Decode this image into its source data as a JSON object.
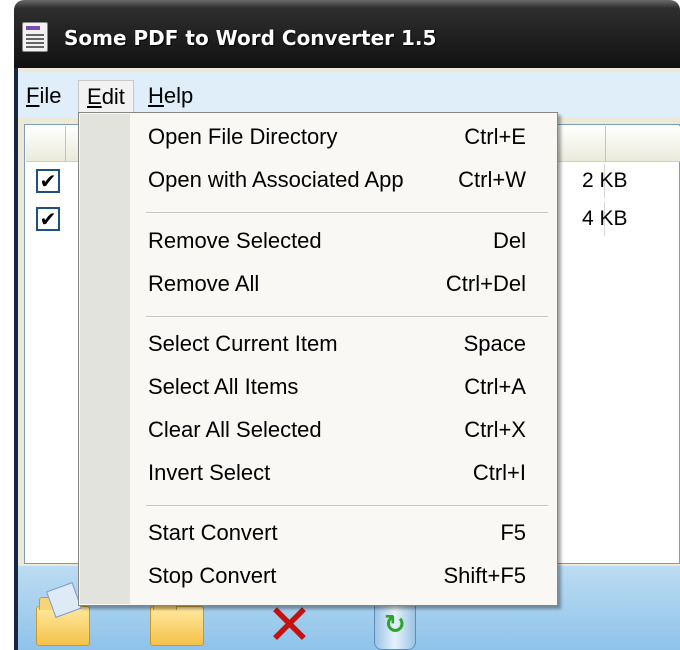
{
  "window": {
    "title": "Some PDF to Word Converter 1.5"
  },
  "menubar": {
    "items": [
      {
        "label": "File",
        "mnemonic": "F",
        "rest": "ile"
      },
      {
        "label": "Edit",
        "mnemonic": "E",
        "rest": "dit"
      },
      {
        "label": "Help",
        "mnemonic": "H",
        "rest": "elp"
      }
    ]
  },
  "edit_menu": {
    "groups": [
      [
        {
          "label": "Open File Directory",
          "shortcut": "Ctrl+E"
        },
        {
          "label": "Open with Associated App",
          "shortcut": "Ctrl+W"
        }
      ],
      [
        {
          "label": "Remove Selected",
          "shortcut": "Del"
        },
        {
          "label": "Remove All",
          "shortcut": "Ctrl+Del"
        }
      ],
      [
        {
          "label": "Select Current Item",
          "shortcut": "Space"
        },
        {
          "label": "Select All Items",
          "shortcut": "Ctrl+A"
        },
        {
          "label": "Clear All Selected",
          "shortcut": "Ctrl+X"
        },
        {
          "label": "Invert Select",
          "shortcut": "Ctrl+I"
        }
      ],
      [
        {
          "label": "Start Convert",
          "shortcut": "F5"
        },
        {
          "label": "Stop Convert",
          "shortcut": "Shift+F5"
        }
      ]
    ]
  },
  "file_list": {
    "rows": [
      {
        "checked": true,
        "check_glyph": "✔",
        "size_visible": "2 KB"
      },
      {
        "checked": true,
        "check_glyph": "✔",
        "size_visible": "4 KB"
      }
    ]
  },
  "toolbar": {
    "buttons": [
      {
        "icon": "open-file-folder-icon"
      },
      {
        "icon": "open-folder-icon"
      },
      {
        "icon": "remove-x-icon"
      },
      {
        "icon": "recycle-bin-icon"
      }
    ]
  },
  "colors": {
    "titlebar": "#111111",
    "menubar": "#dfeef8",
    "menu_background": "#f9f8f4",
    "menu_gutter": "#e3e3dd",
    "toolbar": "#8fc3ea",
    "remove_icon": "#c81010"
  }
}
